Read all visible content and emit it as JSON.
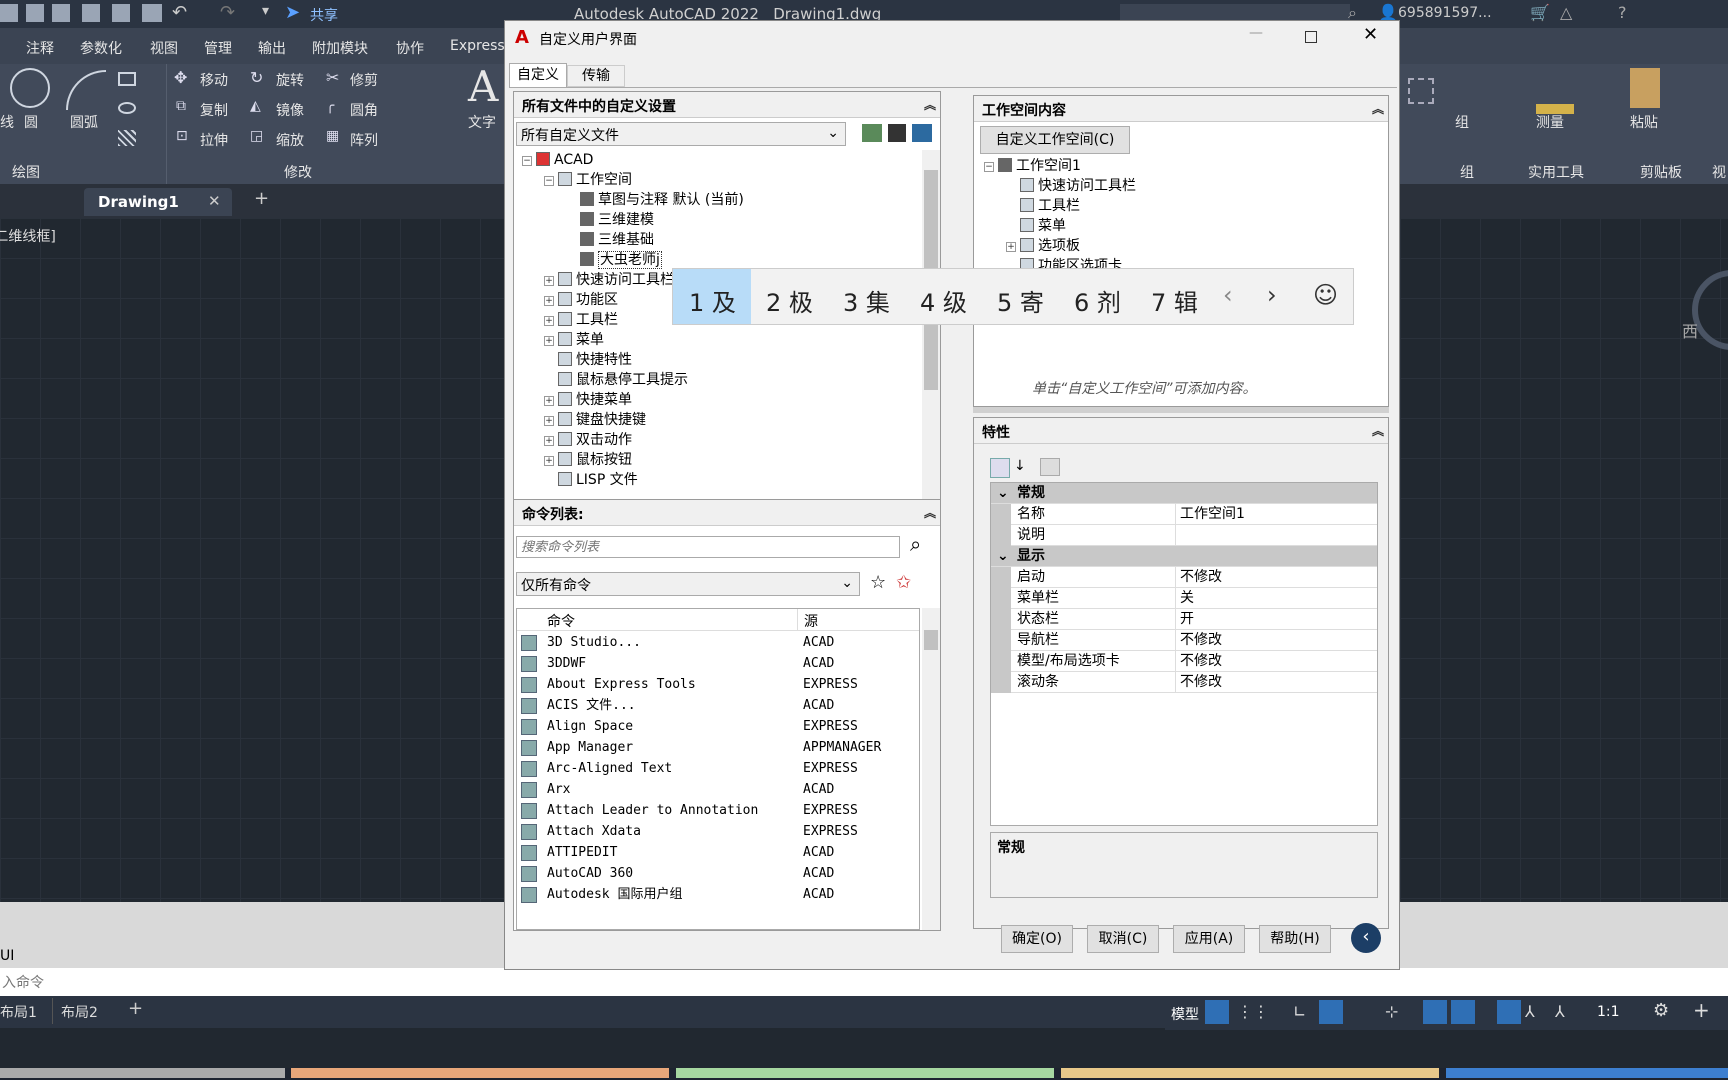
{
  "app": {
    "title": "Autodesk AutoCAD 2022",
    "file": "Drawing1.dwg",
    "user": "695891597...",
    "share": "共享"
  },
  "ribbon": {
    "tabs": [
      "注释",
      "参数化",
      "视图",
      "管理",
      "输出",
      "附加模块",
      "协作",
      "Express"
    ],
    "draw": {
      "line_partial": "线",
      "circle": "圆",
      "arc": "圆弧",
      "group_label": "绘图"
    },
    "modify": {
      "move": "移动",
      "rotate": "旋转",
      "trim": "修剪",
      "copy": "复制",
      "mirror": "镜像",
      "fillet": "圆角",
      "stretch": "拉伸",
      "scale": "缩放",
      "array": "阵列",
      "group_label": "修改"
    },
    "text": "文字",
    "right": {
      "group": "组",
      "measure": "测量",
      "paste": "粘贴",
      "group_label": "组",
      "utilities": "实用工具",
      "clipboard": "剪贴板",
      "view_partial": "视"
    }
  },
  "doc_tab": {
    "name": "Drawing1"
  },
  "viewport_label": "[-][俯视][二维线框]",
  "viewcube_label": "西",
  "command": {
    "history": "UI",
    "prompt": "入命令"
  },
  "layouts": [
    "布局1",
    "布局2"
  ],
  "status": {
    "model": "模型",
    "scale": "1:1"
  },
  "dialog": {
    "title": "自定义用户界面",
    "tabs": [
      "自定义",
      "传输"
    ],
    "left_top": {
      "header": "所有文件中的自定义设置",
      "dropdown": "所有自定义文件",
      "tree": [
        {
          "label": "ACAD",
          "level": 0,
          "expander": "−"
        },
        {
          "label": "工作空间",
          "level": 1,
          "expander": "−"
        },
        {
          "label": "草图与注释 默认 (当前)",
          "level": 2,
          "expander": ""
        },
        {
          "label": "三维建模",
          "level": 2,
          "expander": ""
        },
        {
          "label": "三维基础",
          "level": 2,
          "expander": ""
        },
        {
          "label": "大虫老师j",
          "level": 2,
          "expander": ""
        },
        {
          "label": "快速访问工具栏",
          "level": 1,
          "expander": "+"
        },
        {
          "label": "功能区",
          "level": 1,
          "expander": "+"
        },
        {
          "label": "工具栏",
          "level": 1,
          "expander": "+"
        },
        {
          "label": "菜单",
          "level": 1,
          "expander": "+"
        },
        {
          "label": "快捷特性",
          "level": 1,
          "expander": ""
        },
        {
          "label": "鼠标悬停工具提示",
          "level": 1,
          "expander": ""
        },
        {
          "label": "快捷菜单",
          "level": 1,
          "expander": "+"
        },
        {
          "label": "键盘快捷键",
          "level": 1,
          "expander": "+"
        },
        {
          "label": "双击动作",
          "level": 1,
          "expander": "+"
        },
        {
          "label": "鼠标按钮",
          "level": 1,
          "expander": "+"
        },
        {
          "label": "LISP 文件",
          "level": 1,
          "expander": ""
        }
      ]
    },
    "left_bottom": {
      "header": "命令列表:",
      "search_placeholder": "搜索命令列表",
      "filter": "仅所有命令",
      "columns": [
        "命令",
        "源"
      ],
      "rows": [
        {
          "name": "3D Studio...",
          "source": "ACAD"
        },
        {
          "name": "3DDWF",
          "source": "ACAD"
        },
        {
          "name": "About Express Tools",
          "source": "EXPRESS"
        },
        {
          "name": "ACIS 文件...",
          "source": "ACAD"
        },
        {
          "name": "Align Space",
          "source": "EXPRESS"
        },
        {
          "name": "App Manager",
          "source": "APPMANAGER"
        },
        {
          "name": "Arc-Aligned Text",
          "source": "EXPRESS"
        },
        {
          "name": "Arx",
          "source": "ACAD"
        },
        {
          "name": "Attach Leader to Annotation",
          "source": "EXPRESS"
        },
        {
          "name": "Attach Xdata",
          "source": "EXPRESS"
        },
        {
          "name": "ATTIPEDIT",
          "source": "ACAD"
        },
        {
          "name": "AutoCAD 360",
          "source": "ACAD"
        },
        {
          "name": "Autodesk 国际用户组",
          "source": "ACAD"
        }
      ]
    },
    "right_top": {
      "header": "工作空间内容",
      "button": "自定义工作空间(C)",
      "tree": [
        {
          "label": "工作空间1",
          "level": 0,
          "expander": "−"
        },
        {
          "label": "快速访问工具栏",
          "level": 1,
          "expander": ""
        },
        {
          "label": "工具栏",
          "level": 1,
          "expander": ""
        },
        {
          "label": "菜单",
          "level": 1,
          "expander": ""
        },
        {
          "label": "选项板",
          "level": 1,
          "expander": "+"
        },
        {
          "label": "功能区选项卡",
          "level": 1,
          "expander": ""
        }
      ],
      "hint": "单击“自定义工作空间”可添加内容。"
    },
    "properties": {
      "header": "特性",
      "rows": [
        {
          "key": "常规",
          "value": "",
          "category": true
        },
        {
          "key": "名称",
          "value": "工作空间1",
          "category": false
        },
        {
          "key": "说明",
          "value": "",
          "category": false
        },
        {
          "key": "显示",
          "value": "",
          "category": true
        },
        {
          "key": "启动",
          "value": "不修改",
          "category": false
        },
        {
          "key": "菜单栏",
          "value": "关",
          "category": false
        },
        {
          "key": "状态栏",
          "value": "开",
          "category": false
        },
        {
          "key": "导航栏",
          "value": "不修改",
          "category": false
        },
        {
          "key": "模型/布局选项卡",
          "value": "不修改",
          "category": false
        },
        {
          "key": "滚动条",
          "value": "不修改",
          "category": false
        }
      ],
      "description_title": "常规"
    },
    "buttons": {
      "ok": "确定(O)",
      "cancel": "取消(C)",
      "apply": "应用(A)",
      "help": "帮助(H)"
    }
  },
  "ime": {
    "candidates": [
      "1 及",
      "2 极",
      "3 集",
      "4 级",
      "5 寄",
      "6 剂",
      "7 辑"
    ]
  }
}
